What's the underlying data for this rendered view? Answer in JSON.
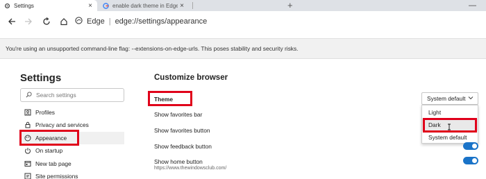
{
  "tabs": [
    {
      "title": "Settings",
      "close": "×"
    },
    {
      "title": "enable dark theme in Edge - Go",
      "close": "×"
    }
  ],
  "new_tab_label": "+",
  "window": {
    "minimize": "—"
  },
  "address_bar": {
    "browser_label": "Edge",
    "separator": "|",
    "url": "edge://settings/appearance"
  },
  "warning": "You're using an unsupported command-line flag: --extensions-on-edge-urls. This poses stability and security risks.",
  "sidebar": {
    "title": "Settings",
    "search_placeholder": "Search settings",
    "items": [
      {
        "label": "Profiles",
        "icon": "profile-icon"
      },
      {
        "label": "Privacy and services",
        "icon": "lock-icon"
      },
      {
        "label": "Appearance",
        "icon": "palette-icon",
        "active": true
      },
      {
        "label": "On startup",
        "icon": "power-icon"
      },
      {
        "label": "New tab page",
        "icon": "new-tab-icon"
      },
      {
        "label": "Site permissions",
        "icon": "permissions-icon"
      }
    ]
  },
  "main": {
    "heading": "Customize browser",
    "theme": {
      "label": "Theme",
      "value": "System default"
    },
    "theme_options": [
      "Light",
      "Dark",
      "System default"
    ],
    "rows": [
      {
        "label": "Show favorites bar"
      },
      {
        "label": "Show favorites button"
      },
      {
        "label": "Show feedback button",
        "toggle": true
      },
      {
        "label": "Show home button",
        "toggle": true
      }
    ],
    "home_url": "https://www.thewindowsclub.com/"
  },
  "colors": {
    "accent": "#1a73c8",
    "highlight": "#e0001a"
  }
}
